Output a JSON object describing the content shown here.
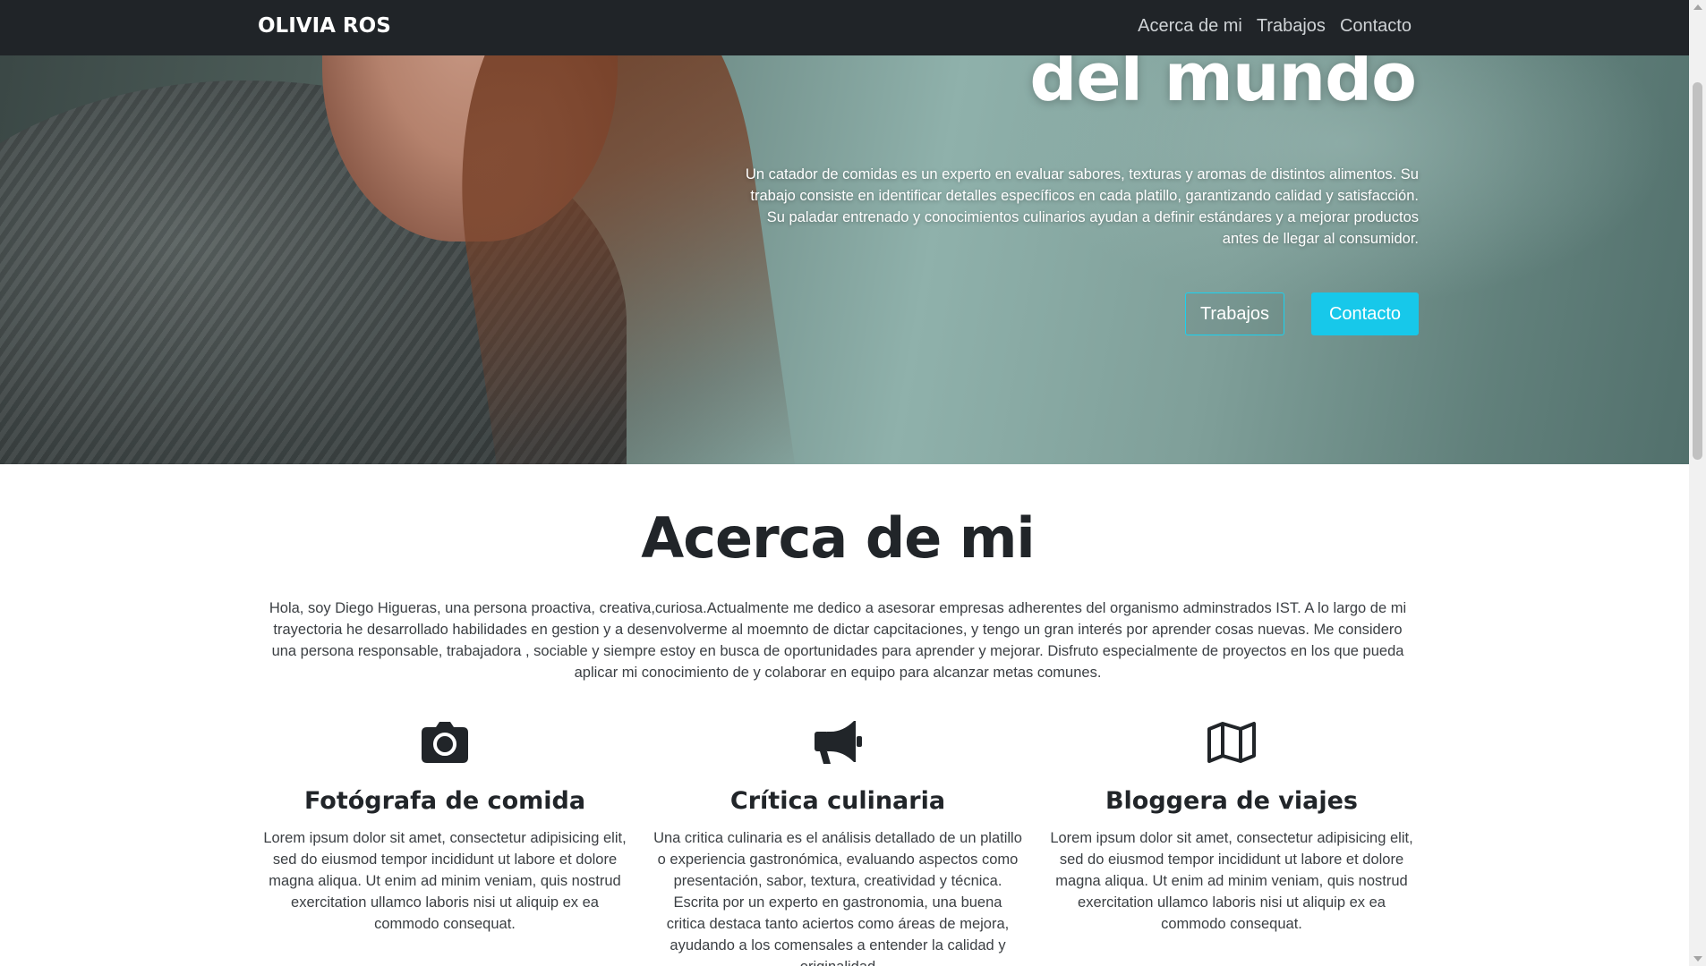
{
  "navbar": {
    "brand": "OLIVIA ROS",
    "links": [
      "Acerca de mi",
      "Trabajos",
      "Contacto"
    ]
  },
  "hero": {
    "title_partial": "del mundo",
    "lead": "Un catador de comidas es un experto en evaluar sabores, texturas y aromas de distintos alimentos. Su trabajo consiste en identificar detalles específicos en cada platillo, garantizando calidad y satisfacción. Su paladar entrenado y conocimientos culinarios ayudan a definir estándares y a mejorar productos antes de llegar al consumidor.",
    "button_outline": "Trabajos",
    "button_solid": "Contacto",
    "accent_color": "#17c8ea"
  },
  "about": {
    "title": "Acerca de mi",
    "text": "Hola, soy Diego Higueras, una persona proactiva, creativa,curiosa.Actualmente me dedico a asesorar empresas adherentes del organismo adminstrados IST. A lo largo de mi trayectoria he desarrollado habilidades en gestion y a desenvolverme al moemnto de dictar capcitaciones, y tengo un gran interés por aprender cosas nuevas. Me considero una persona responsable, trabajadora , sociable y siempre estoy en busca de oportunidades para aprender y mejorar. Disfruto especialmente de proyectos en los que pueda aplicar mi conocimiento de y colaborar en equipo para alcanzar metas comunes."
  },
  "features": [
    {
      "icon": "camera-icon",
      "title": "Fotógrafa de comida",
      "text": "Lorem ipsum dolor sit amet, consectetur adipisicing elit, sed do eiusmod tempor incididunt ut labore et dolore magna aliqua. Ut enim ad minim veniam, quis nostrud exercitation ullamco laboris nisi ut aliquip ex ea commodo consequat."
    },
    {
      "icon": "megaphone-icon",
      "title": "Crítica culinaria",
      "text": "Una critica culinaria es el análisis detallado de un platillo o experiencia gastronómica, evaluando aspectos como presentación, sabor, textura, creatividad y técnica. Escrita por un experto en gastronomia, una buena critica destaca tanto aciertos como áreas de mejora, ayudando a los comensales a entender la calidad y originalidad"
    },
    {
      "icon": "map-icon",
      "title": "Bloggera de viajes",
      "text": "Lorem ipsum dolor sit amet, consectetur adipisicing elit, sed do eiusmod tempor incididunt ut labore et dolore magna aliqua. Ut enim ad minim veniam, quis nostrud exercitation ullamco laboris nisi ut aliquip ex ea commodo consequat."
    }
  ]
}
